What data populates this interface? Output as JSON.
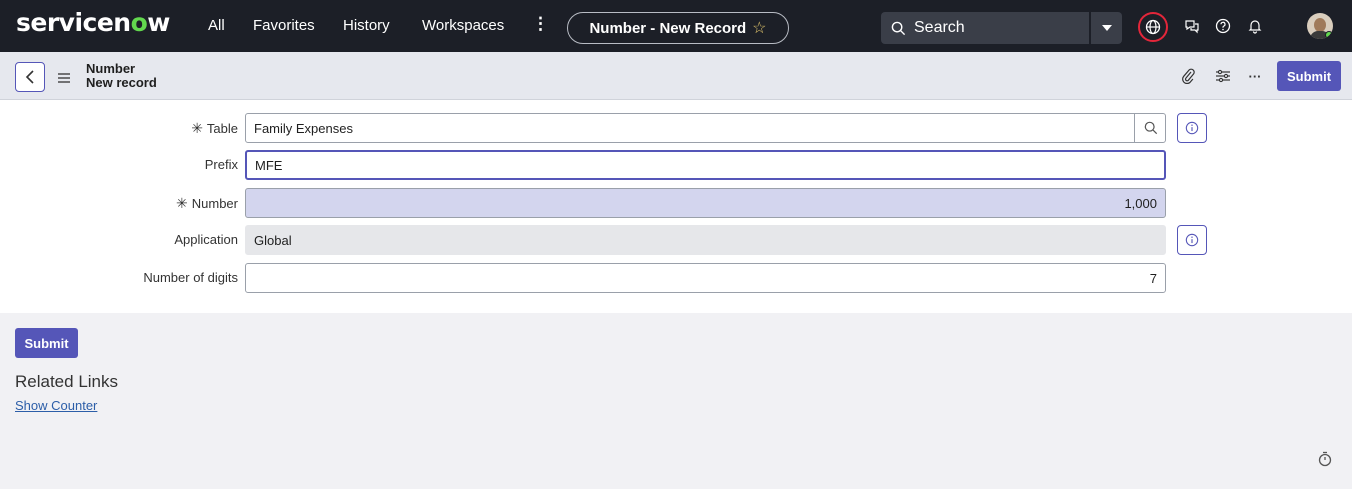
{
  "nav": {
    "logo_main": "servicen",
    "logo_o": "o",
    "logo_end": "w",
    "links": [
      "All",
      "Favorites",
      "History",
      "Workspaces"
    ],
    "more_glyph": "⋮",
    "record_pill": "Number - New Record",
    "star_glyph": "☆",
    "search_placeholder": "Search",
    "icons": [
      "globe-icon",
      "chat-icon",
      "help-icon",
      "bell-icon",
      "avatar"
    ]
  },
  "header": {
    "title_line1": "Number",
    "title_line2": "New record",
    "submit_label": "Submit",
    "icons": [
      "back-icon",
      "menu-icon",
      "paperclip-icon",
      "settings-sliders-icon",
      "more-icon"
    ],
    "more_glyph": "···"
  },
  "form": {
    "fields": [
      {
        "label": "Table",
        "required": true,
        "value": "Family Expenses"
      },
      {
        "label": "Prefix",
        "required": false,
        "value": "MFE"
      },
      {
        "label": "Number",
        "required": true,
        "value": "1,000"
      },
      {
        "label": "Application",
        "required": false,
        "value": "Global"
      },
      {
        "label": "Number of digits",
        "required": false,
        "value": "7"
      }
    ],
    "required_glyph": "✳"
  },
  "footer": {
    "submit_label": "Submit",
    "related_links_title": "Related Links",
    "show_counter_link": "Show Counter"
  },
  "colors": {
    "nav_bg": "#1c1f27",
    "accent": "#5556b8",
    "logo_green": "#62d84e",
    "alert_red": "#e3263a",
    "number_field_bg": "#d3d5ee"
  }
}
